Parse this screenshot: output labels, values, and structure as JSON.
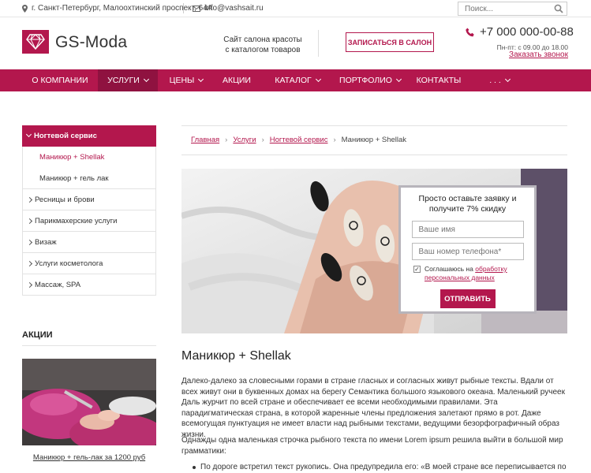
{
  "topbar": {
    "address": "г. Санкт-Петербург, Малоохтинский проспект, 64А",
    "email": "info@vashsait.ru",
    "search_placeholder": "Поиск..."
  },
  "header": {
    "logo": "GS-Moda",
    "tagline_line1": "Сайт салона красоты",
    "tagline_line2": "с каталогом товаров",
    "book_button": "ЗАПИСАТЬСЯ В САЛОН",
    "phone": "+7 000 000-00-88",
    "hours": "Пн-пт: с 09.00 до 18.00",
    "callback": "Заказать звонок"
  },
  "nav": {
    "items": [
      {
        "label": "О КОМПАНИИ"
      },
      {
        "label": "УСЛУГИ"
      },
      {
        "label": "ЦЕНЫ"
      },
      {
        "label": "АКЦИИ"
      },
      {
        "label": "КАТАЛОГ"
      },
      {
        "label": "ПОРТФОЛИО"
      },
      {
        "label": "КОНТАКТЫ"
      },
      {
        "label": ". . ."
      }
    ]
  },
  "sidebar": {
    "active": "Ногтевой сервис",
    "sub_items": [
      "Маникюр + Shellak",
      "Маникюр + гель лак"
    ],
    "items": [
      "Ресницы и брови",
      "Парикмахерские услуги",
      "Визаж",
      "Услуги косметолога",
      "Массаж, SPA"
    ],
    "promo_heading": "АКЦИИ",
    "promo_caption": "Маникюр + гель-лак за 1200 руб"
  },
  "breadcrumbs": {
    "home": "Главная",
    "services": "Услуги",
    "nail": "Ногтевой сервис",
    "current": "Маникюр + Shellak"
  },
  "form": {
    "title_line1": "Просто оставьте заявку и",
    "title_line2": "получите 7% скидку",
    "name_placeholder": "Ваше имя",
    "phone_placeholder": "Ваш номер телефона*",
    "agree_text": "Соглашаюсь на ",
    "agree_link": "обработку персональных данных",
    "submit": "ОТПРАВИТЬ"
  },
  "content": {
    "title": "Маникюр + Shellak",
    "para1": "Далеко-далеко за словесными горами в стране гласных и согласных живут рыбные тексты. Вдали от всех живут они в буквенных домах на берегу Семантика большого языкового океана. Маленький ручеек Даль журчит по всей стране и обеспечивает ее всеми необходимыми правилами. Эта парадигматическая страна, в которой жаренные члены предложения залетают прямо в рот. Даже всемогущая пунктуация не имеет власти над рыбными текстами, ведущими безорфографичный образ жизни.",
    "para2": "Однажды одна маленькая строчка рыбного текста по имени Lorem ipsum решила выйти в большой мир грамматики:",
    "bullet1": "По дороге встретил текст рукопись. Она предупредила его: «В моей стране все переписывается по"
  },
  "colors": {
    "brand": "#b3174d",
    "brand_dark": "#8f1240"
  }
}
